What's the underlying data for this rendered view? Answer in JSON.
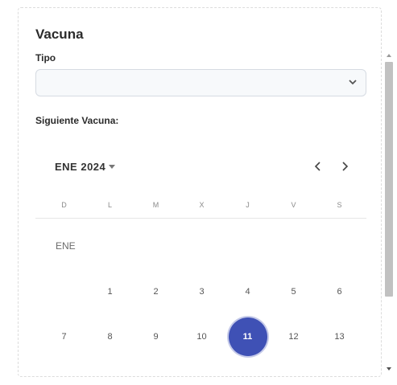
{
  "card": {
    "title": "Vacuna",
    "tipo_label": "Tipo",
    "tipo_value": "",
    "next_vaccine_label": "Siguiente Vacuna:"
  },
  "calendar": {
    "month_year": "ENE 2024",
    "weekdays": [
      "D",
      "L",
      "M",
      "X",
      "J",
      "V",
      "S"
    ],
    "month_label": "ENE",
    "row1": [
      "",
      "1",
      "2",
      "3",
      "4",
      "5",
      "6"
    ],
    "row2": [
      "7",
      "8",
      "9",
      "10",
      "11",
      "12",
      "13"
    ],
    "selected_day": "11",
    "accent_color": "#3f51b5"
  },
  "icons": {
    "select": "chevron-down-icon",
    "month_dropdown": "caret-down-icon",
    "prev": "chevron-left-icon",
    "next": "chevron-right-icon"
  }
}
